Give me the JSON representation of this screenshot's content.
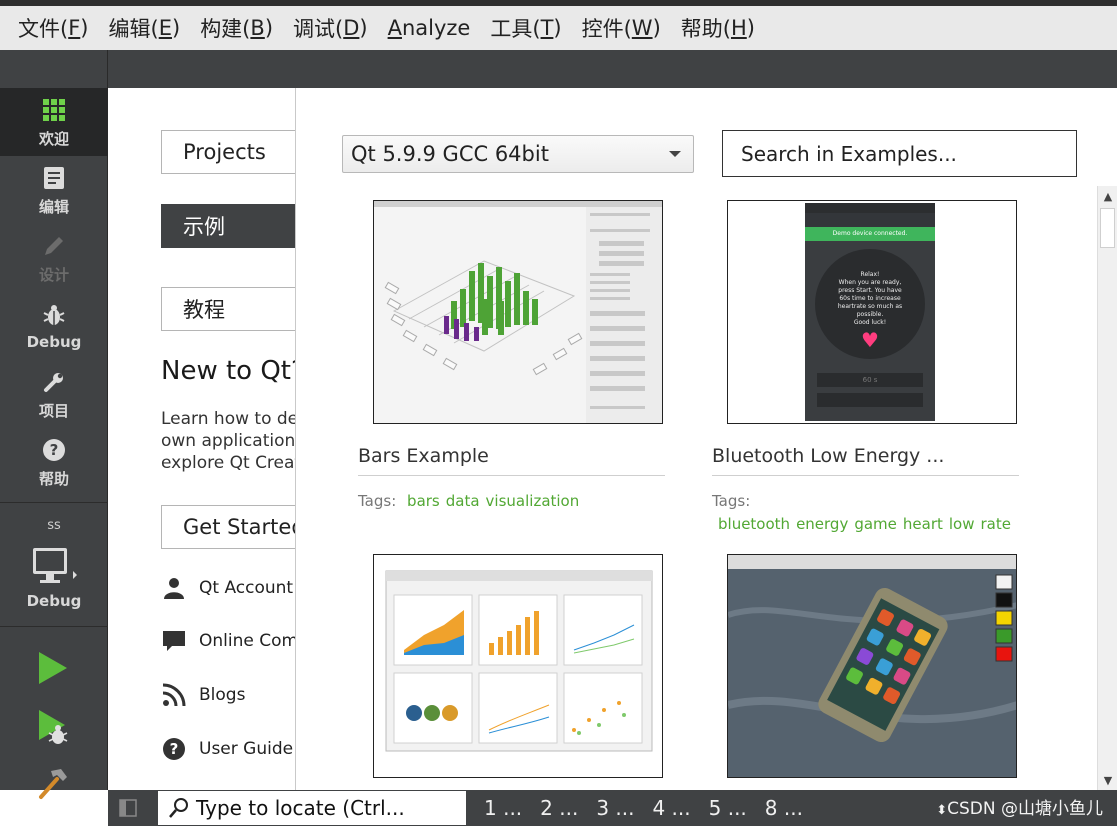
{
  "menubar": {
    "items": [
      {
        "text": "文件(",
        "acc": "F",
        "end": ")"
      },
      {
        "text": "编辑(",
        "acc": "E",
        "end": ")"
      },
      {
        "text": "构建(",
        "acc": "B",
        "end": ")"
      },
      {
        "text": "调试(",
        "acc": "D",
        "end": ")"
      },
      {
        "text": "",
        "acc": "A",
        "end": "nalyze"
      },
      {
        "text": "工具(",
        "acc": "T",
        "end": ")"
      },
      {
        "text": "控件(",
        "acc": "W",
        "end": ")"
      },
      {
        "text": "帮助(",
        "acc": "H",
        "end": ")"
      }
    ]
  },
  "sidebar": {
    "modes": [
      "欢迎",
      "编辑",
      "设计",
      "Debug",
      "项目",
      "帮助"
    ],
    "kit_name": "ss",
    "kit_label": "Debug"
  },
  "welcome": {
    "projects": "Projects",
    "examples": "示例",
    "tutorials": "教程",
    "heading": "New to Qt?",
    "intro": [
      "Learn how to develop your",
      "own applications and",
      "explore Qt Creator."
    ],
    "get_started": "Get Started Now",
    "links": [
      "Qt Account",
      "Online Community",
      "Blogs",
      "User Guide"
    ]
  },
  "examples": {
    "kit_selected": "Qt 5.9.9 GCC 64bit",
    "search_placeholder": "Search in Examples...",
    "tags_label": "Tags:",
    "cards": [
      {
        "title": "Bars Example",
        "tags": [
          "bars",
          "data",
          "visualization"
        ]
      },
      {
        "title": "Bluetooth Low Energy ...",
        "tags": [
          "bluetooth",
          "energy",
          "game",
          "heart",
          "low",
          "rate"
        ]
      }
    ],
    "thumbs": {
      "ble_relax": [
        "Relax!",
        "When you are ready,",
        "press Start. You have",
        "60s time to increase",
        "heartrate so much as",
        "possible.",
        "Good luck!"
      ],
      "ble_status": "Demo device connected.",
      "ble_timer": "60 s"
    }
  },
  "statusbar": {
    "locator": "Type to locate (Ctrl...",
    "panes": [
      "1 ...",
      "2 ...",
      "3 ...",
      "4 ...",
      "5 ...",
      "8 ..."
    ],
    "watermark": "CSDN @山塘小鱼儿"
  },
  "colors": {
    "sidebar": "#404244",
    "tag_green": "#52a834",
    "active_mode": "#262728"
  },
  "icons": [
    "grid-icon",
    "document-icon",
    "pencil-icon",
    "bug-icon",
    "wrench-icon",
    "help-icon",
    "monitor-icon",
    "run-icon",
    "debug-run-icon",
    "hammer-icon",
    "search-icon",
    "user-icon",
    "chat-icon",
    "rss-icon"
  ]
}
